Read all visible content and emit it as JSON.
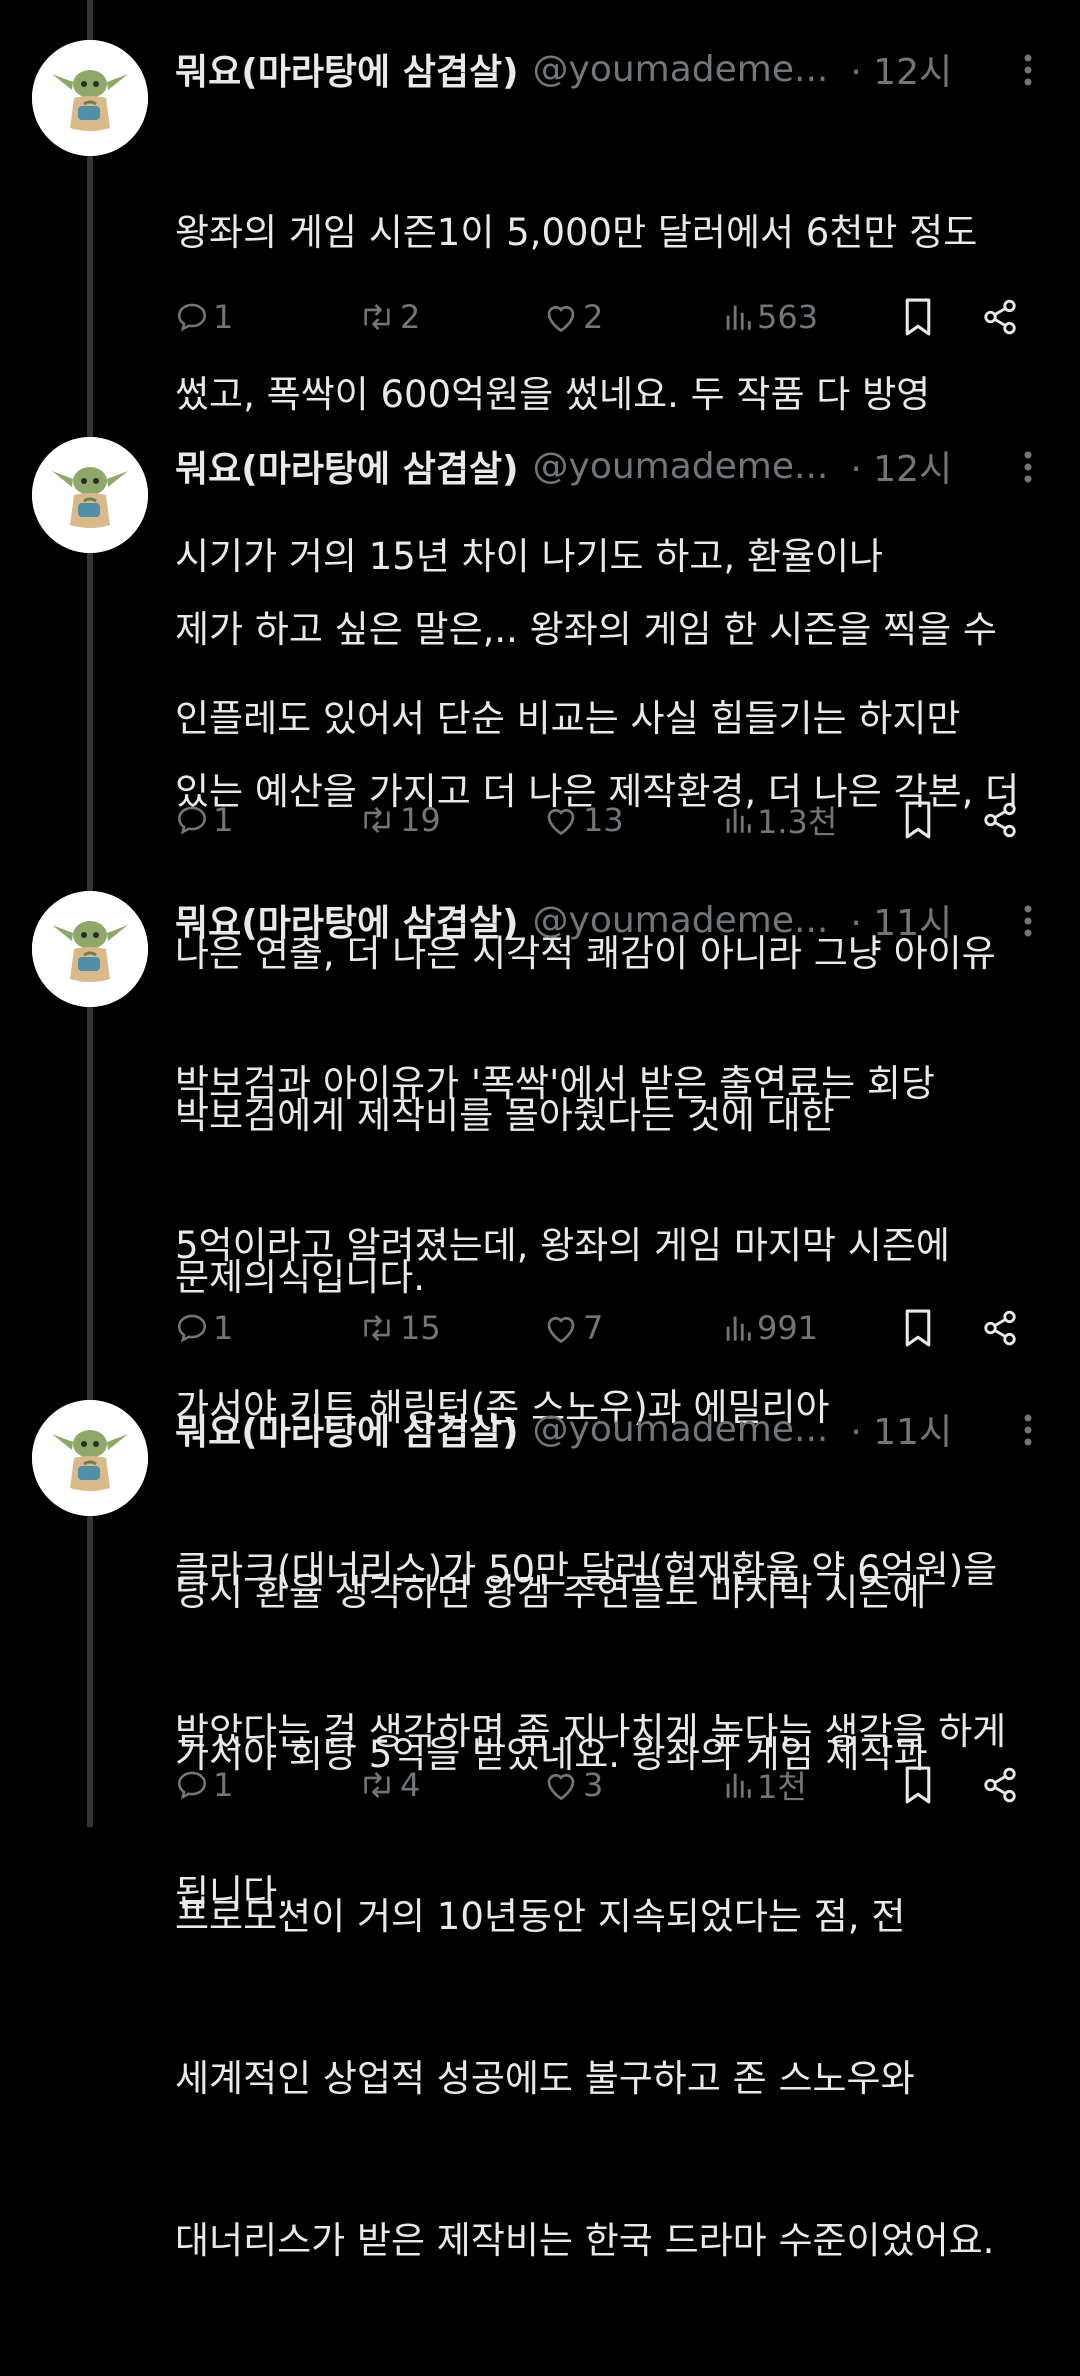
{
  "tweets": [
    {
      "display_name": "뭐요(마라탕에 삼겹살)",
      "handle": "@youmademe...",
      "time": "· 12시",
      "lines": [
        "왕좌의 게임 시즌1이 5,000만 달러에서 6천만 정도",
        "썼고, 폭싹이 600억원을 썼네요. 두 작품 다 방영",
        "시기가 거의 15년 차이 나기도 하고, 환율이나",
        "인플레도 있어서 단순 비교는 사실 힘들기는 하지만"
      ],
      "replies": "1",
      "retweets": "2",
      "likes": "2",
      "views": "563"
    },
    {
      "display_name": "뭐요(마라탕에 삼겹살)",
      "handle": "@youmademe...",
      "time": "· 12시",
      "lines": [
        "제가 하고 싶은 말은,.. 왕좌의 게임 한 시즌을 찍을 수",
        "있는 예산을 가지고 더 나은 제작환경, 더 나은 각본, 더",
        "나은 연출, 더 나은 시각적 쾌감이 아니라 그냥 아이유",
        "박보검에게 제작비를 몰아줬다는 것에 대한",
        "문제의식입니다."
      ],
      "replies": "1",
      "retweets": "19",
      "likes": "13",
      "views": "1.3천"
    },
    {
      "display_name": "뭐요(마라탕에 삼겹살)",
      "handle": "@youmademe...",
      "time": "· 11시",
      "lines": [
        "박보검과 아이유가 '폭싹'에서 받은 출연료는 회당",
        "5억이라고 알려졌는데, 왕좌의 게임 마지막 시즌에",
        "가서야 키트 해링턴(존 스노우)과 에밀리아",
        "클라크(대너리스)가 50만 달러(현재환율 약 6억원)을",
        "받았다는 걸 생각하면 좀 지나치게 높다는 생각을 하게",
        "됩니다."
      ],
      "replies": "1",
      "retweets": "15",
      "likes": "7",
      "views": "991"
    },
    {
      "display_name": "뭐요(마라탕에 삼겹살)",
      "handle": "@youmademe...",
      "time": "· 11시",
      "lines": [
        "당시 환율 생각하면 왕겜 주연들도 마지막 시즌에",
        "가서야 회당 5억을 받았네요. 왕좌의 게임 제작과",
        "프로모션이 거의 10년동안 지속되었다는 점, 전",
        "세계적인 상업적 성공에도 불구하고 존 스노우와",
        "대너리스가 받은 제작비는 한국 드라마 수준이었어요."
      ],
      "replies": "1",
      "retweets": "4",
      "likes": "3",
      "views": "1천"
    }
  ],
  "colors": {
    "background": "#000000",
    "text": "#e7e9ea",
    "secondary": "#71767b",
    "thread_line": "#333639"
  },
  "icons": [
    "reply-icon",
    "retweet-icon",
    "like-icon",
    "views-icon",
    "bookmark-icon",
    "share-icon",
    "more-icon"
  ]
}
